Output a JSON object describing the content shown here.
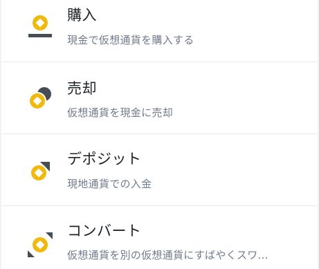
{
  "menu": {
    "items": [
      {
        "title": "購入",
        "description": "現金で仮想通貨を購入する",
        "icon": "buy-icon"
      },
      {
        "title": "売却",
        "description": "仮想通貨を現金に売却",
        "icon": "sell-icon"
      },
      {
        "title": "デポジット",
        "description": "現地通貨での入金",
        "icon": "deposit-icon"
      },
      {
        "title": "コンバート",
        "description": "仮想通貨を別の仮想通貨にすばやくスワ…",
        "icon": "convert-icon"
      }
    ]
  },
  "colors": {
    "accent": "#f0b90b",
    "dark": "#474d57",
    "title": "#1e2329",
    "description": "#707a8a",
    "divider": "#e6e8ea"
  }
}
